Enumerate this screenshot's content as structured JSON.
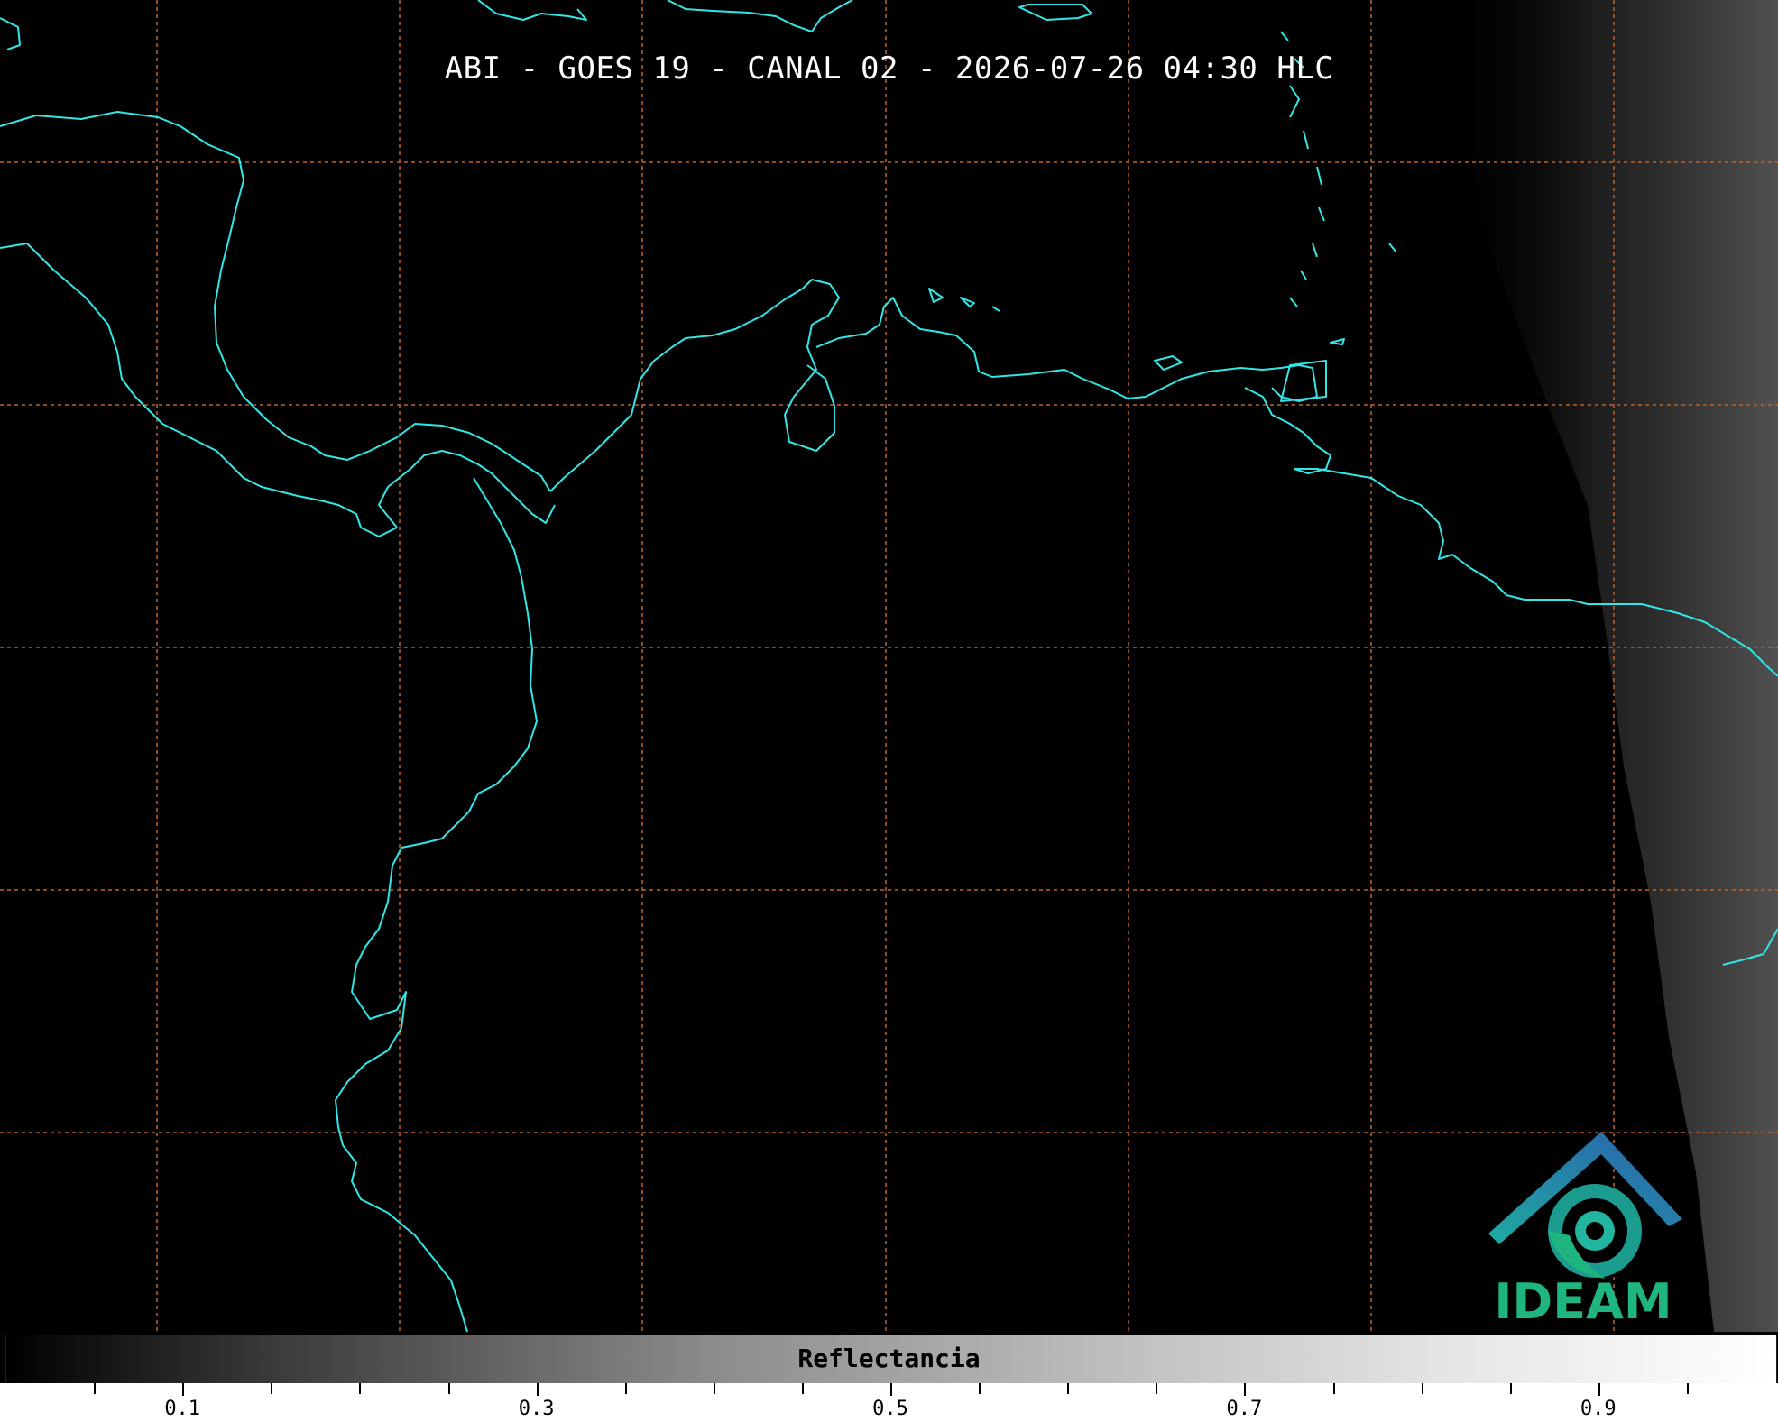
{
  "title": "ABI - GOES 19 - CANAL 02 - 2026-07-26 04:30 HLC",
  "logo": {
    "text": "IDEAM"
  },
  "colorbar": {
    "label": "Reflectancia",
    "ticks": [
      "0.1",
      "0.3",
      "0.5",
      "0.7",
      "0.9"
    ]
  },
  "colors": {
    "coastline": "#33e6e6",
    "grid": "#c0622a",
    "background": "#000000",
    "logo_green": "#1fb57e",
    "logo_blue": "#2a6fb0"
  }
}
